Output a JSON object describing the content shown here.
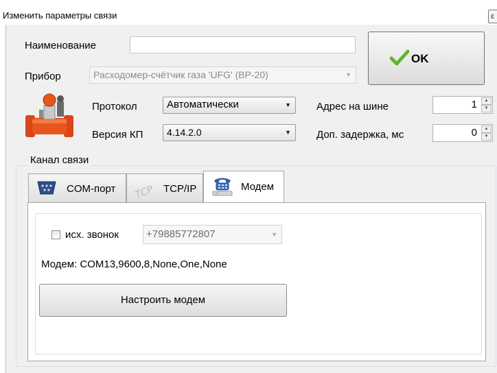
{
  "window": {
    "title": "Изменить параметры связи"
  },
  "form": {
    "name_label": "Наименование",
    "name_value": "",
    "device_label": "Прибор",
    "device_value": "Расходомер-счётчик газа 'UFG' (BP-20)",
    "protocol_label": "Протокол",
    "protocol_value": "Автоматически",
    "version_label": "Версия КП",
    "version_value": "4.14.2.0",
    "address_label": "Адрес на шине",
    "address_value": "1",
    "delay_label": "Доп. задержка, мс",
    "delay_value": "0"
  },
  "ok_button": {
    "label": "OK"
  },
  "channel": {
    "group_title": "Канал связи",
    "tabs": [
      {
        "label": "COM-порт",
        "icon": "serial-port-icon",
        "active": false
      },
      {
        "label": "TCP/IP",
        "icon": "tcp-icon",
        "active": false
      },
      {
        "label": "Модем",
        "icon": "modem-phone-icon",
        "active": true
      }
    ],
    "modem": {
      "outgoing_call_label": "исх. звонок",
      "outgoing_call_checked": false,
      "phone_value": "+79885772807",
      "modem_info": "Модем: COM13,9600,8,None,One,None",
      "configure_button": "Настроить модем"
    }
  },
  "colors": {
    "window_bg": "#f0f0f0",
    "ok_check": "#5cb82a",
    "device_icon_orange": "#e8551d"
  }
}
